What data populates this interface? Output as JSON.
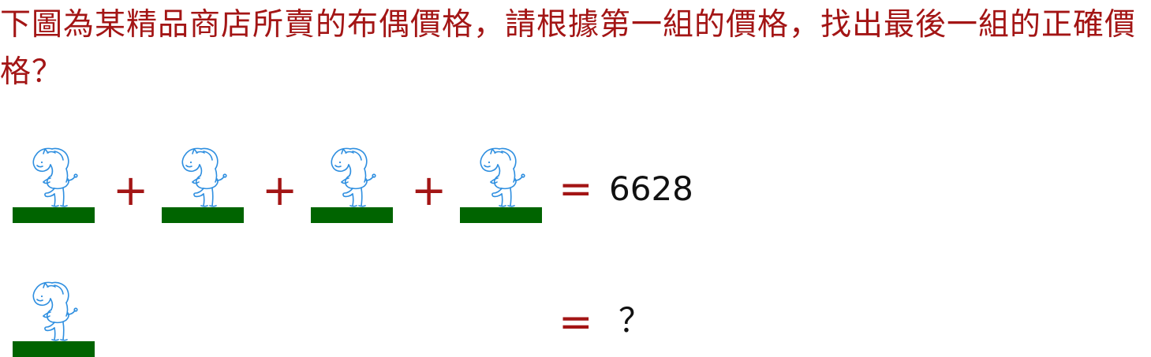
{
  "question": {
    "text": "下圖為某精品商店所賣的布偶價格，請根據第一組的價格，找出最後一組的正確價格？"
  },
  "row1": {
    "plus_sign": "+",
    "equals_sign": "=",
    "result": "6628"
  },
  "row2": {
    "equals_sign": "=",
    "result": "？"
  },
  "colors": {
    "question_text": "#a31515",
    "operators": "#a31515",
    "shelf": "#006400",
    "doll_outline": "#2f8fe0",
    "result_text": "#111111"
  },
  "icons": {
    "doll": "unicorn-doll-icon",
    "shelf": "green-shelf"
  }
}
